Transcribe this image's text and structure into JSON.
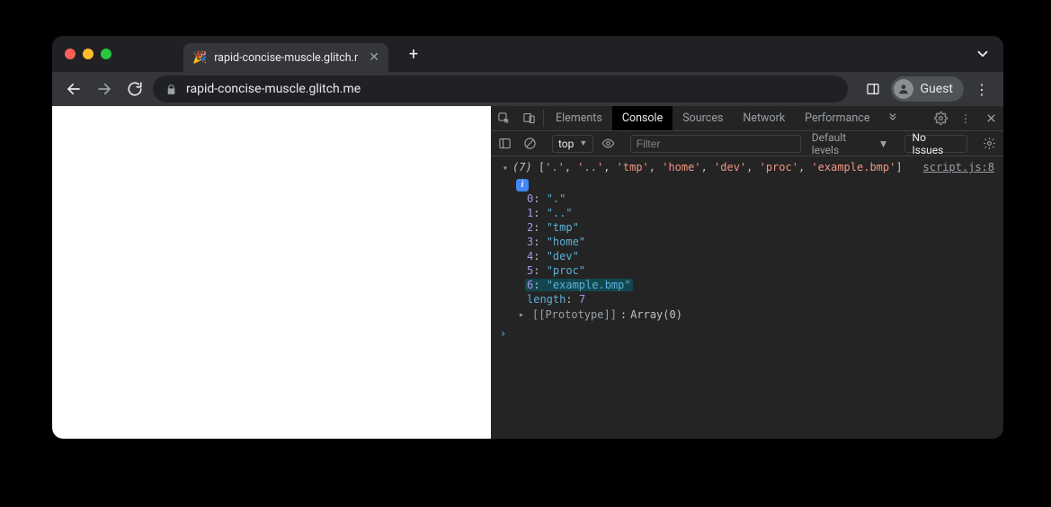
{
  "tab": {
    "title": "rapid-concise-muscle.glitch.me",
    "favicon": "🎉"
  },
  "address": {
    "url": "rapid-concise-muscle.glitch.me"
  },
  "profile": {
    "label": "Guest"
  },
  "devtools": {
    "tabs": {
      "elements": "Elements",
      "console": "Console",
      "sources": "Sources",
      "network": "Network",
      "performance": "Performance"
    },
    "toolbar": {
      "context": "top",
      "filter_placeholder": "Filter",
      "levels": "Default levels",
      "issues": "No Issues"
    },
    "log": {
      "source": "script.js:8",
      "count": "(7)",
      "preview": [
        "'.'",
        "'..'",
        "'tmp'",
        "'home'",
        "'dev'",
        "'proc'",
        "'example.bmp'"
      ],
      "entries": [
        {
          "key": "0",
          "val": "\".\""
        },
        {
          "key": "1",
          "val": "\"..\""
        },
        {
          "key": "2",
          "val": "\"tmp\""
        },
        {
          "key": "3",
          "val": "\"home\""
        },
        {
          "key": "4",
          "val": "\"dev\""
        },
        {
          "key": "5",
          "val": "\"proc\""
        },
        {
          "key": "6",
          "val": "\"example.bmp\"",
          "highlight": true
        }
      ],
      "length_key": "length",
      "length_val": "7",
      "proto_label": "[[Prototype]]",
      "proto_val": "Array(0)"
    }
  }
}
